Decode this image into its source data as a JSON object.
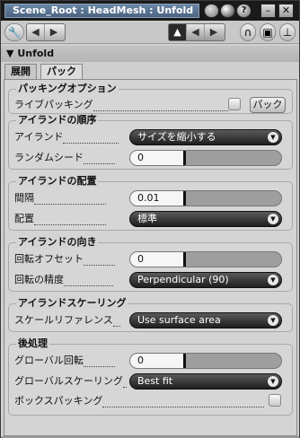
{
  "window": {
    "title": "Scene_Root : HeadMesh : Unfold",
    "title_icons": [
      "sphere-icon",
      "contrast-icon",
      "help-icon"
    ],
    "controls": [
      "minimize",
      "close"
    ]
  },
  "toolbar": {
    "nav_icons": [
      "wrench-icon",
      "back-arrow-icon",
      "forward-arrow-icon"
    ],
    "right_icons": [
      "up-arrow-icon",
      "left-arrow-icon",
      "right-arrow-icon",
      "magnet-icon",
      "copy-icon",
      "pin-icon"
    ]
  },
  "header": {
    "label": "Unfold"
  },
  "tabs": [
    {
      "label": "展開"
    },
    {
      "label": "パック"
    }
  ],
  "packing": {
    "title": "パッキングオプション",
    "live_packing_label": "ライブパッキング",
    "pack_button": "パック"
  },
  "island_order": {
    "title": "アイランドの順序",
    "island_label": "アイランド",
    "island_value": "サイズを縮小する",
    "seed_label": "ランダムシード",
    "seed_value": "0"
  },
  "island_layout": {
    "title": "アイランドの配置",
    "spacing_label": "間隔",
    "spacing_value": "0.01",
    "layout_label": "配置",
    "layout_value": "標準"
  },
  "island_orientation": {
    "title": "アイランドの向き",
    "offset_label": "回転オフセット",
    "offset_value": "0",
    "precision_label": "回転の精度",
    "precision_value": "Perpendicular (90)"
  },
  "island_scaling": {
    "title": "アイランドスケーリング",
    "ref_label": "スケールリファレンス",
    "ref_value": "Use surface area"
  },
  "post": {
    "title": "後処理",
    "global_rot_label": "グローバル回転",
    "global_rot_value": "0",
    "global_scale_label": "グローバルスケーリング",
    "global_scale_value": "Best fit",
    "box_pack_label": "ボックスパッキング"
  }
}
